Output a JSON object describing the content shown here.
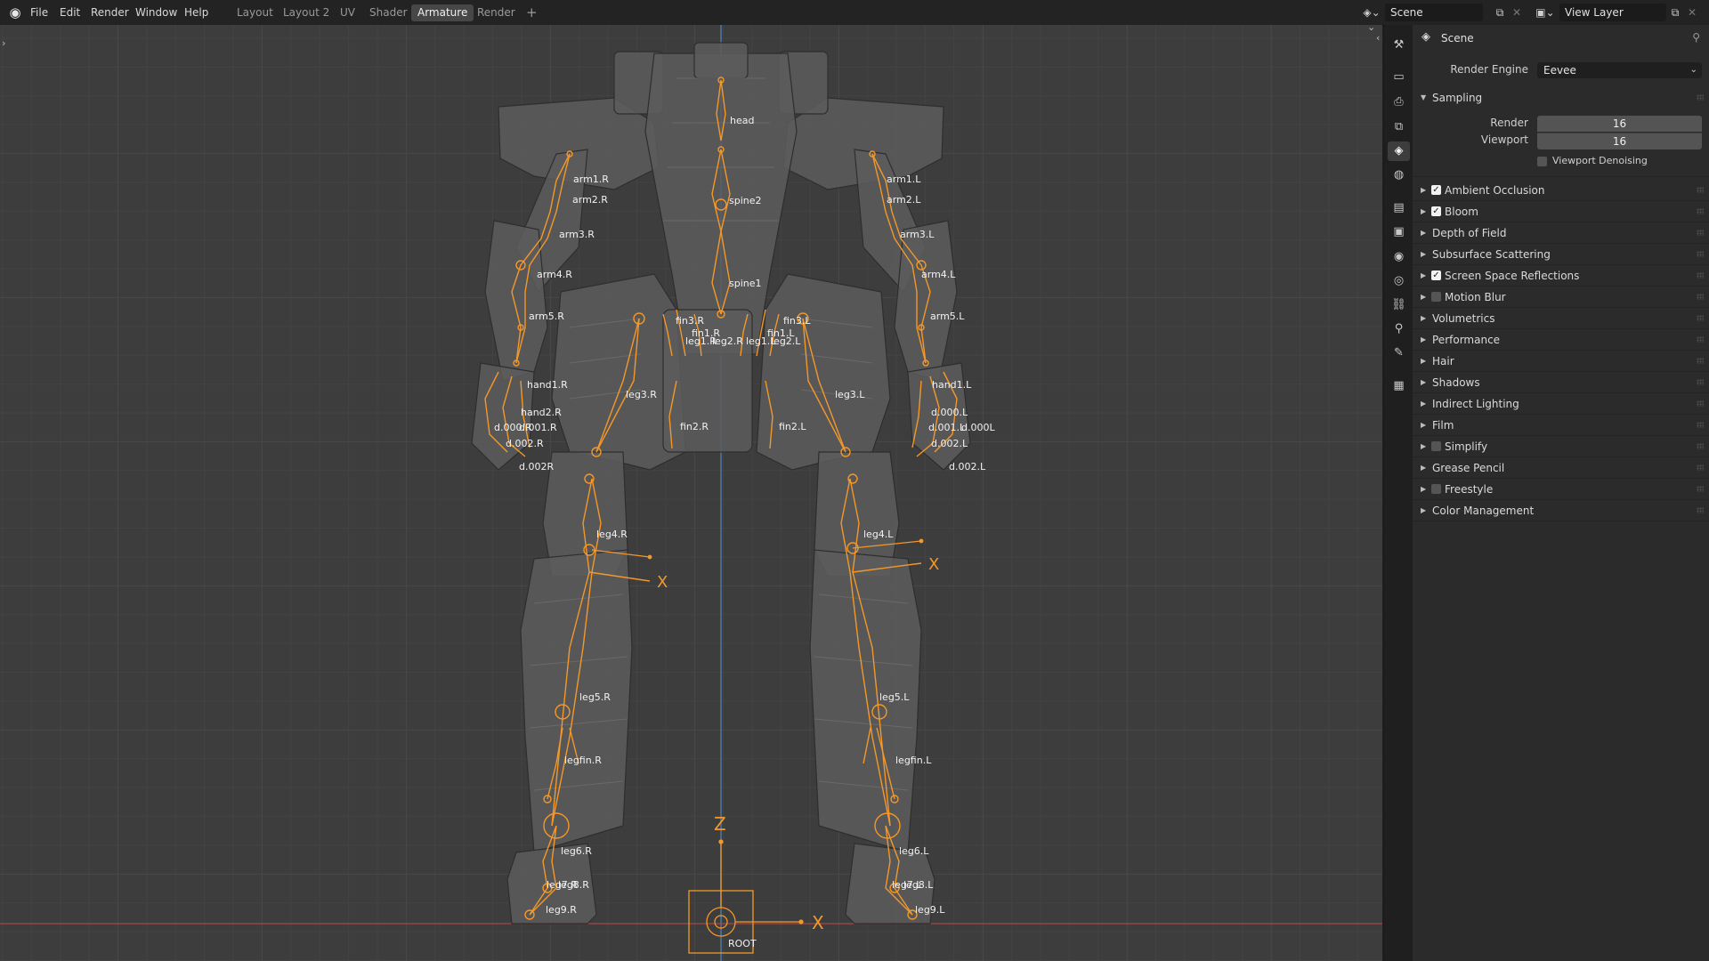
{
  "menu": [
    "File",
    "Edit",
    "Render",
    "Window",
    "Help"
  ],
  "workspaces": [
    {
      "label": "Layout",
      "active": false
    },
    {
      "label": "Layout 2",
      "active": false
    },
    {
      "label": "UV",
      "active": false
    },
    {
      "label": "Shader",
      "active": false
    },
    {
      "label": "Armature",
      "active": true
    },
    {
      "label": "Render",
      "active": false
    }
  ],
  "add_workspace": "+",
  "scene_selector": {
    "value": "Scene",
    "icon": "scene-icon"
  },
  "view_layer_selector": {
    "value": "View Layer",
    "icon": "render-layers-icon"
  },
  "properties": {
    "header_title": "Scene",
    "render_engine": {
      "label": "Render Engine",
      "value": "Eevee"
    },
    "sampling": {
      "title": "Sampling",
      "render_label": "Render",
      "render_value": "16",
      "viewport_label": "Viewport",
      "viewport_value": "16",
      "denoise_label": "Viewport Denoising",
      "denoise_checked": false
    },
    "panels": [
      {
        "label": "Ambient Occlusion",
        "checkbox": true,
        "checked": true
      },
      {
        "label": "Bloom",
        "checkbox": true,
        "checked": true
      },
      {
        "label": "Depth of Field",
        "checkbox": false
      },
      {
        "label": "Subsurface Scattering",
        "checkbox": false
      },
      {
        "label": "Screen Space Reflections",
        "checkbox": true,
        "checked": true
      },
      {
        "label": "Motion Blur",
        "checkbox": true,
        "checked": false
      },
      {
        "label": "Volumetrics",
        "checkbox": false
      },
      {
        "label": "Performance",
        "checkbox": false
      },
      {
        "label": "Hair",
        "checkbox": false
      },
      {
        "label": "Shadows",
        "checkbox": false
      },
      {
        "label": "Indirect Lighting",
        "checkbox": false
      },
      {
        "label": "Film",
        "checkbox": false
      },
      {
        "label": "Simplify",
        "checkbox": true,
        "checked": false
      },
      {
        "label": "Grease Pencil",
        "checkbox": false
      },
      {
        "label": "Freestyle",
        "checkbox": true,
        "checked": false
      },
      {
        "label": "Color Management",
        "checkbox": false
      }
    ]
  },
  "property_tabs": [
    "tool-icon",
    "render-icon",
    "output-icon",
    "view-layer-icon",
    "scene-icon",
    "world-icon",
    "collection-icon",
    "object-icon",
    "modifier-icon",
    "physics-icon",
    "constraint-icon",
    "data-icon",
    "bone-icon",
    "texture-icon"
  ],
  "viewport": {
    "axis_labels": {
      "z": "Z",
      "x": "X"
    },
    "colors": {
      "bone": "#f3982a",
      "y_axis": "#4b79a6",
      "x_axis": "#a34848",
      "mesh": "#5e5e5e"
    },
    "bones": [
      "head",
      "spine2",
      "spine1",
      "arm1.R",
      "arm2.R",
      "arm3.R",
      "arm4.R",
      "arm5.R",
      "arm1.L",
      "arm2.L",
      "arm3.L",
      "arm4.L",
      "arm5.L",
      "hand1.R",
      "hand2.R",
      "d.001.R",
      "d.002.R",
      "d.000.R",
      "d.002R",
      "hand1.L",
      "d.000.L",
      "d.001.L",
      "d.002.L",
      "d.000L",
      "d.002.L",
      "fin3.R",
      "fin1.R",
      "fin2.R",
      "fin3.L",
      "fin1.L",
      "fin2.L",
      "leg1.R",
      "leg1.L",
      "leg2.R",
      "leg2.L",
      "leg3.R",
      "leg3.L",
      "leg4.R",
      "leg4.L",
      "leg5.R",
      "leg5.L",
      "legfin.R",
      "legfin.L",
      "leg6.R",
      "leg6.L",
      "leg7.R",
      "leg8.R",
      "leg7.L",
      "leg8.L",
      "leg9.R",
      "leg9.L",
      "ROOT"
    ]
  }
}
